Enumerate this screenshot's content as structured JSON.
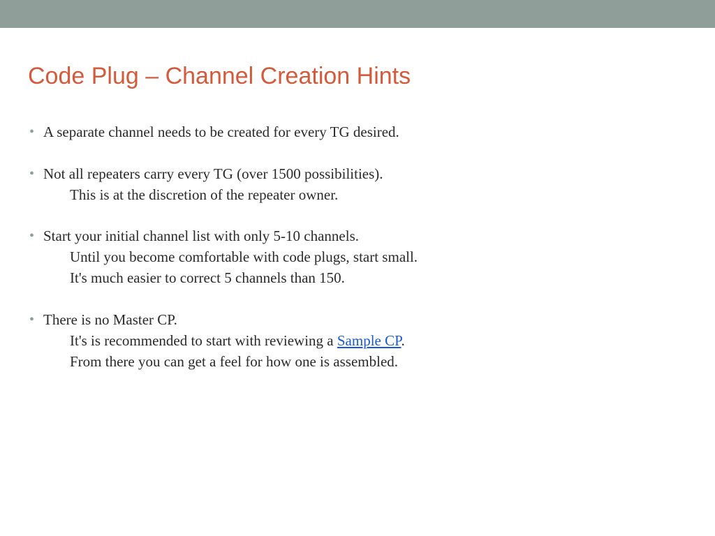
{
  "title": "Code Plug – Channel Creation Hints",
  "bullets": {
    "b0": {
      "main": "A separate channel needs to be created for every TG desired."
    },
    "b1": {
      "main": "Not all repeaters carry every TG (over 1500 possibilities).",
      "sub1": "This is at the discretion of the repeater owner."
    },
    "b2": {
      "main": "Start your initial channel list with only 5-10 channels.",
      "sub1": "Until you become comfortable with code plugs, start small.",
      "sub2": "It's much easier to correct 5 channels than 150."
    },
    "b3": {
      "main": "There is no Master CP.",
      "sub1_prefix": "It's is recommended to start with reviewing a  ",
      "sub1_link": "Sample CP",
      "sub1_suffix": ".",
      "sub2": "From there you can get a feel for how one is assembled."
    }
  }
}
